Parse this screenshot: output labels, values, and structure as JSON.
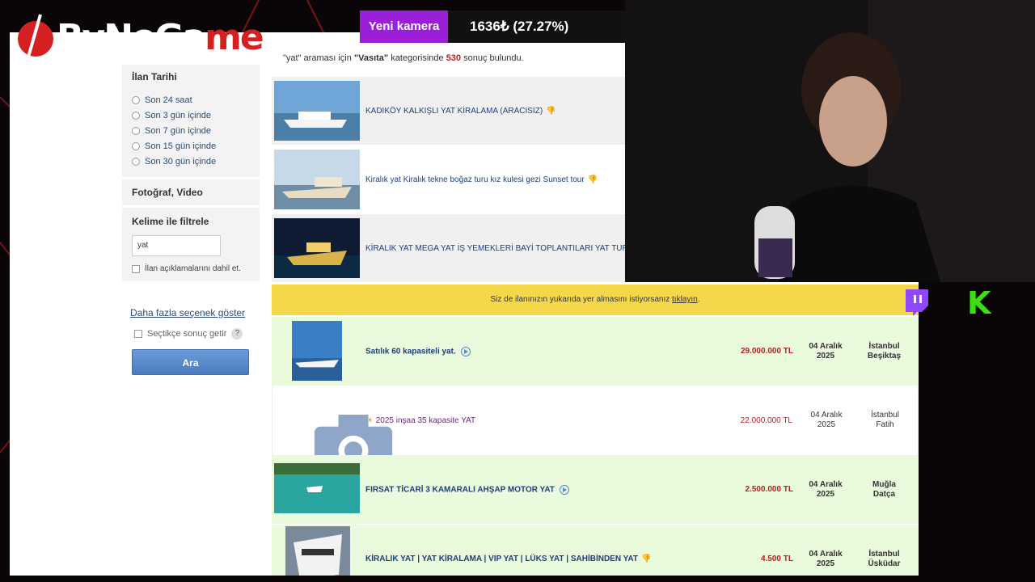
{
  "branding": {
    "logo_text_main": "ByNoGa",
    "logo_text_accent": "me"
  },
  "stream": {
    "badge": "Yeni kamera",
    "counter": "1636₺ (27.27%)"
  },
  "search_info": {
    "prefix": "\"yat\" araması için ",
    "category": "\"Vasıta\"",
    "middle": " kategorisinde ",
    "count": "530",
    "suffix": " sonuç bulundu."
  },
  "sidebar": {
    "date_title": "İlan Tarihi",
    "date_options": [
      "Son 24 saat",
      "Son 3 gün içinde",
      "Son 7 gün içinde",
      "Son 15 gün içinde",
      "Son 30 gün içinde"
    ],
    "media_title": "Fotoğraf, Video",
    "keyword_title": "Kelime ile filtrele",
    "keyword_value": "yat",
    "include_desc_label": "İlan açıklamalarını dahil et.",
    "more_options": "Daha fazla seçenek göster",
    "selective_label": "Seçtikçe sonuç getir",
    "help": "?",
    "search_button": "Ara"
  },
  "banner": {
    "text": "Siz de ilanınızın yukarıda yer almasını istiyorsanız ",
    "link": "tıklayın",
    "end": "."
  },
  "listings_top": [
    {
      "title": "KADIKÖY KALKIŞLI YAT KİRALAMA (ARACISIZ)"
    },
    {
      "title": "Kiralık yat Kiralık tekne boğaz turu kız kulesi gezi Sunset tour"
    },
    {
      "title": "KİRALIK YAT MEGA YAT İŞ YEMEKLERİ BAYİ TOPLANTILARI YAT TUR"
    }
  ],
  "listings": [
    {
      "title": "Satılık 60 kapasiteli yat.",
      "price": "29.000.000 TL",
      "date1": "04 Aralık",
      "date2": "2025",
      "city": "İstanbul",
      "district": "Beşiktaş"
    },
    {
      "title": "2025 inşaa 35 kapasite YAT",
      "price": "22.000.000 TL",
      "date1": "04 Aralık",
      "date2": "2025",
      "city": "İstanbul",
      "district": "Fatih"
    },
    {
      "title": "FIRSAT TİCARİ 3 KAMARALI AHŞAP MOTOR YAT",
      "price": "2.500.000 TL",
      "date1": "04 Aralık",
      "date2": "2025",
      "city": "Muğla",
      "district": "Datça"
    },
    {
      "title": "KİRALIK YAT | YAT KİRALAMA | VIP YAT | LÜKS YAT | SAHİBİNDEN YAT",
      "price": "4.500 TL",
      "date1": "04 Aralık",
      "date2": "2025",
      "city": "İstanbul",
      "district": "Üsküdar"
    }
  ],
  "colors": {
    "accent_purple": "#9b1fd8",
    "price_red": "#b22222",
    "link_blue": "#1f3e7a",
    "banner_yellow": "#f5d84a",
    "highlight_green": "#eafadc",
    "kick_green": "#3ddc17"
  },
  "icons": [
    "camera-icon",
    "thumbs-down-icon",
    "play-icon",
    "twitch-icon",
    "kick-icon",
    "sun-icon"
  ]
}
